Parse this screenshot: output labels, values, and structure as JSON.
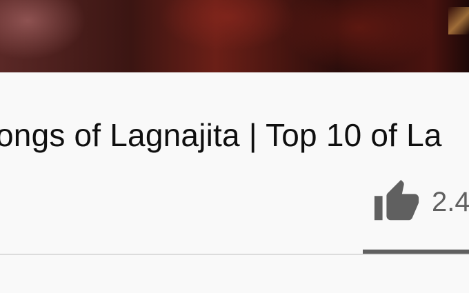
{
  "video": {
    "title": "ongs of Lagnajita | Top 10 of La",
    "like_count": "2.4"
  },
  "colors": {
    "page_background": "#f9f9f9",
    "title_text": "#0f0f0f",
    "icon_gray": "#606060",
    "divider": "#dcdcdc"
  },
  "icons": {
    "like": "thumbs-up-icon"
  }
}
